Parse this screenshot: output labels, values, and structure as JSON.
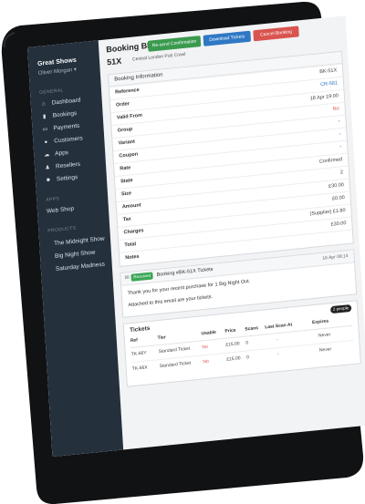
{
  "sidebar": {
    "brand": "Great Shows",
    "user": "Oliver Morgan ▾",
    "general_label": "GENERAL",
    "items": [
      {
        "label": "Dashboard",
        "icon": "home-icon"
      },
      {
        "label": "Bookings",
        "icon": "ticket-icon"
      },
      {
        "label": "Payments",
        "icon": "card-icon"
      },
      {
        "label": "Customers",
        "icon": "users-icon"
      },
      {
        "label": "Apps",
        "icon": "cloud-icon"
      },
      {
        "label": "Resellers",
        "icon": "user-icon"
      },
      {
        "label": "Settings",
        "icon": "gear-icon"
      }
    ],
    "apps_label": "APPS",
    "apps": [
      {
        "label": "Web Shop"
      }
    ],
    "products_label": "PRODUCTS",
    "products": [
      {
        "label": "The Midnight Show"
      },
      {
        "label": "Big Night Show"
      },
      {
        "label": "Saturday Madness"
      }
    ]
  },
  "header": {
    "title": "Booking BK-",
    "booking_ref": "51X",
    "venue": "Central London Pub Crawl",
    "buttons": [
      {
        "label": "Re-send Confirmation",
        "color": "#3a9a4e"
      },
      {
        "label": "Download Tickets",
        "color": "#2f78c4"
      },
      {
        "label": "Cancel Booking",
        "color": "#d9534f"
      }
    ]
  },
  "booking_info": {
    "heading": "Booking Information",
    "rows": [
      {
        "label": "Reference",
        "value": "BK-51X"
      },
      {
        "label": "Order",
        "value": "CR-581"
      },
      {
        "label": "Valid From",
        "value": "18 Apr 19:00"
      },
      {
        "label": "Group",
        "value": "No"
      },
      {
        "label": "Variant",
        "value": "-"
      },
      {
        "label": "Coupon",
        "value": "-"
      },
      {
        "label": "Rate",
        "value": "-"
      },
      {
        "label": "State",
        "value": "Confirmed"
      },
      {
        "label": "Size",
        "value": "2"
      },
      {
        "label": "Amount",
        "value": "£30.00"
      },
      {
        "label": "Tax",
        "value": "£0.00"
      },
      {
        "label": "Charges",
        "value": "(Supplier) £1.80"
      },
      {
        "label": "Total",
        "value": "£30.00"
      },
      {
        "label": "Notes",
        "value": ""
      }
    ]
  },
  "email": {
    "badge": "Received",
    "subject": "Booking #BK-51X Tickets",
    "date": "16 Apr 08:14",
    "line1": "Thank you for your recent purchase for 1 Big Night Out.",
    "line2": "Attached to this email are your tickets."
  },
  "tickets": {
    "heading": "Tickets",
    "count_badge": "2 people",
    "columns": [
      "Ref",
      "Tier",
      "Usable",
      "Price",
      "Scans",
      "Last Scan At",
      "Expires"
    ],
    "rows": [
      {
        "ref": "TK-66Y",
        "tier": "Standard Ticket",
        "usable": "No",
        "price": "£15.00",
        "scans": "0",
        "last_scan": "-",
        "expires": "Never"
      },
      {
        "ref": "TK-66X",
        "tier": "Standard Ticket",
        "usable": "No",
        "price": "£15.00",
        "scans": "0",
        "last_scan": "-",
        "expires": "Never"
      }
    ]
  },
  "colors": {
    "sidebar_bg": "#24303c",
    "link": "#2f78c4",
    "danger": "#d9534f",
    "success": "#3aa655"
  }
}
